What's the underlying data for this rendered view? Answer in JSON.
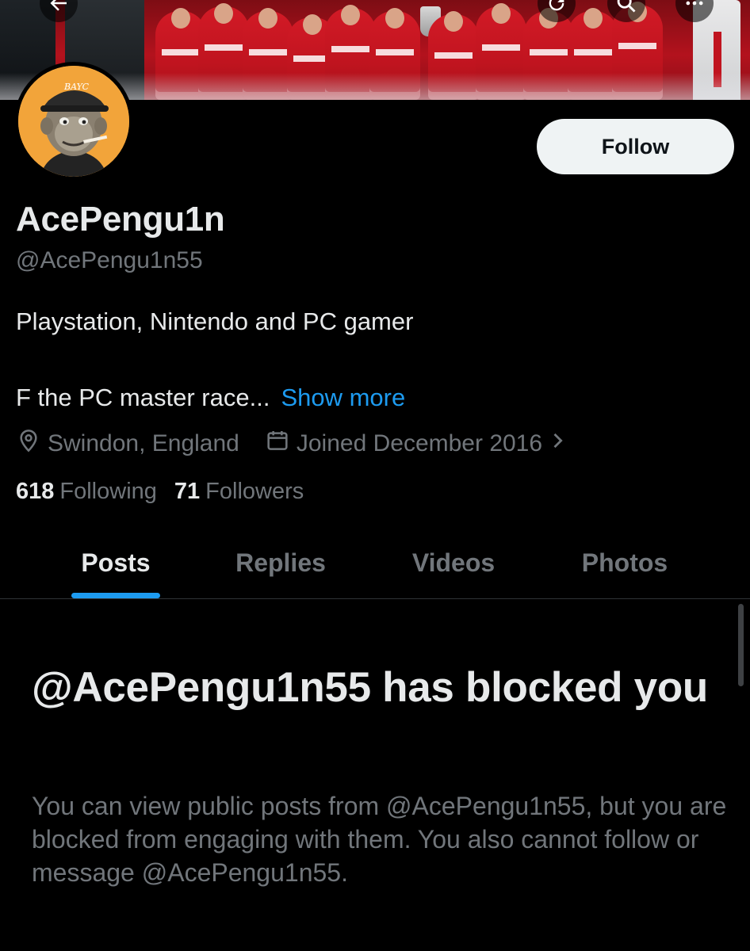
{
  "profile": {
    "display_name": "AcePengu1n",
    "handle": "@AcePengu1n55",
    "bio_line1": "Playstation, Nintendo and PC gamer",
    "bio_line2": "F the PC master race...",
    "show_more_label": "Show more",
    "location": "Swindon, England",
    "joined": "Joined December 2016",
    "following_count": "618",
    "following_label": "Following",
    "followers_count": "71",
    "followers_label": "Followers",
    "avatar_cap_text": "BAYC"
  },
  "actions": {
    "follow_label": "Follow"
  },
  "tabs": [
    {
      "label": "Posts",
      "active": true
    },
    {
      "label": "Replies",
      "active": false
    },
    {
      "label": "Videos",
      "active": false
    },
    {
      "label": "Photos",
      "active": false
    }
  ],
  "blocked_notice": {
    "title": "@AcePengu1n55 has blocked you",
    "description": "You can view public posts from @AcePengu1n55, but you are blocked from engaging with them. You also cannot follow or message @AcePengu1n55."
  },
  "colors": {
    "background": "#000000",
    "accent": "#1d9bf0",
    "primary_text": "#e7e9ea",
    "secondary_text": "#71767b",
    "follow_button_bg": "#eff3f4"
  },
  "icons": [
    "back-arrow-icon",
    "refresh-icon",
    "search-icon",
    "more-icon",
    "location-icon",
    "calendar-icon",
    "chevron-right-icon"
  ]
}
